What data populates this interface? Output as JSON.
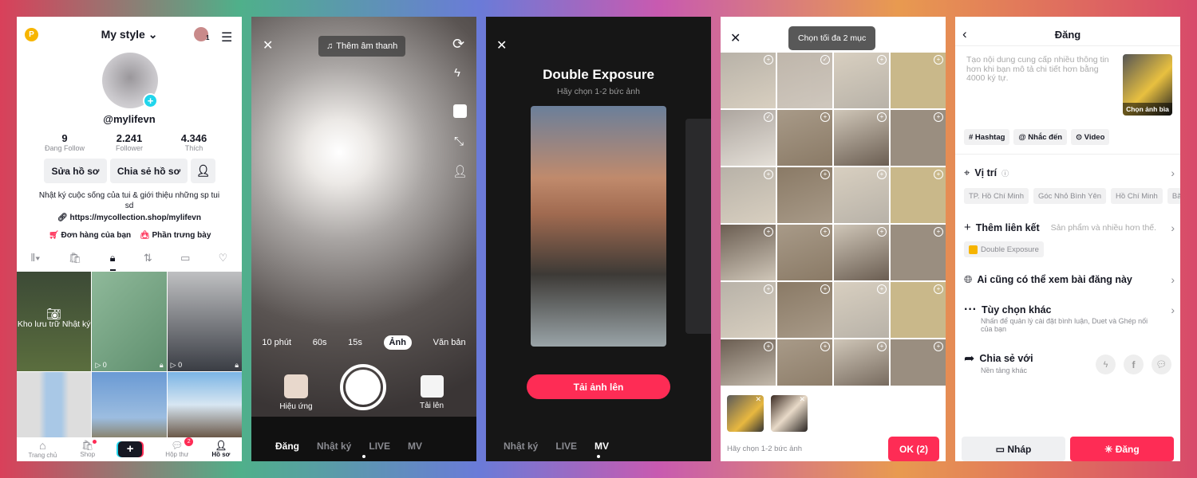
{
  "profile": {
    "title": "My style",
    "username": "@mylifevn",
    "avatar_badge": "1",
    "stats": [
      {
        "value": "9",
        "label": "Đang Follow"
      },
      {
        "value": "2.241",
        "label": "Follower"
      },
      {
        "value": "4.346",
        "label": "Thích"
      }
    ],
    "edit_label": "Sửa hồ sơ",
    "share_label": "Chia sẻ hồ sơ",
    "bio": "Nhật ký cuộc sống của tui & giới thiệu những sp tui sd",
    "link": "https://mycollection.shop/mylifevn",
    "orders": "Đơn hàng của bạn",
    "showcase": "Phần trưng bày",
    "archive": "Kho lưu trữ Nhật ký",
    "grid_views": [
      "0",
      "0"
    ],
    "nav": [
      {
        "label": "Trang chủ"
      },
      {
        "label": "Shop"
      },
      {
        "label": ""
      },
      {
        "label": "Hộp thư",
        "badge": "2"
      },
      {
        "label": "Hồ sơ"
      }
    ],
    "accent": "#fe2c55",
    "cyan": "#20d5ec"
  },
  "camera": {
    "add_sound": "Thêm âm thanh",
    "durations": [
      "10 phút",
      "60s",
      "15s",
      "Ảnh",
      "Văn bản"
    ],
    "selected_duration": "Ảnh",
    "effects": "Hiệu ứng",
    "upload": "Tải lên",
    "modes": [
      "Đăng",
      "Nhật ký",
      "LIVE",
      "MV"
    ]
  },
  "template": {
    "title": "Double Exposure",
    "subtitle": "Hãy chọn 1-2 bức ảnh",
    "upload_button": "Tải ảnh lên",
    "modes": [
      "Nhật ký",
      "LIVE",
      "MV"
    ]
  },
  "picker": {
    "toast": "Chọn tối đa 2 mục",
    "hint": "Hãy chọn 1-2 bức ảnh",
    "ok": "OK (2)"
  },
  "post": {
    "title": "Đăng",
    "placeholder": "Tạo nội dung cung cấp nhiều thông tin hơn khi bạn mô tả chi tiết hơn bằng 4000 ký tự.",
    "cover": "Chọn ảnh bìa",
    "tags": [
      "# Hashtag",
      "@ Nhắc đến",
      "⊙ Video"
    ],
    "location": "Vị trí",
    "location_chips": [
      "TP. Hồ Chí Minh",
      "Góc Nhỏ Bình Yên",
      "Hồ Chí Minh",
      "Bãi b"
    ],
    "add_link": "Thêm liên kết",
    "add_link_hint": "Sản phẩm và nhiều hơn thế.",
    "template_chip": "Double Exposure",
    "privacy": "Ai cũng có thể xem bài đăng này",
    "more": "Tùy chọn khác",
    "more_sub": "Nhấn để quản lý cài đặt bình luận, Duet và Ghép nối của bạn",
    "share": "Chia sẻ với",
    "share_sub": "Nền tảng khác",
    "draft": "Nháp",
    "publish": "Đăng"
  }
}
